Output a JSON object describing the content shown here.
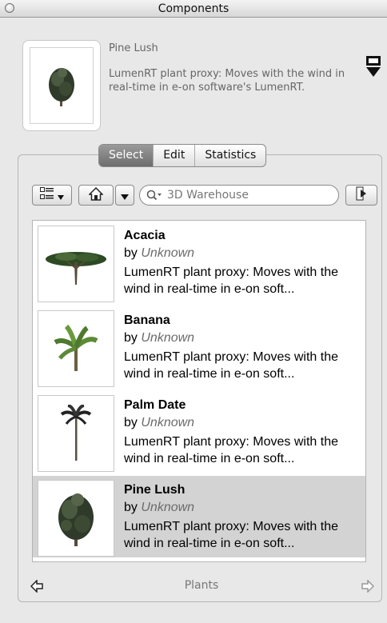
{
  "window": {
    "title": "Components"
  },
  "selected_component": {
    "name": "Pine Lush",
    "description": "LumenRT plant proxy: Moves with the wind in real-time in e-on software's LumenRT."
  },
  "tabs": [
    {
      "label": "Select",
      "active": true
    },
    {
      "label": "Edit",
      "active": false
    },
    {
      "label": "Statistics",
      "active": false
    }
  ],
  "search": {
    "placeholder": "3D Warehouse"
  },
  "items": [
    {
      "name": "Acacia",
      "by_prefix": "by",
      "author": "Unknown",
      "description": "LumenRT plant proxy: Moves with the wind in real-time in e-on soft...",
      "selected": false,
      "thumb": "acacia-tree-icon"
    },
    {
      "name": "Banana",
      "by_prefix": "by",
      "author": "Unknown",
      "description": "LumenRT plant proxy: Moves with the wind in real-time in e-on soft...",
      "selected": false,
      "thumb": "banana-plant-icon"
    },
    {
      "name": "Palm Date",
      "by_prefix": "by",
      "author": "Unknown",
      "description": "LumenRT plant proxy: Moves with the wind in real-time in e-on soft...",
      "selected": false,
      "thumb": "palm-tree-icon"
    },
    {
      "name": "Pine Lush",
      "by_prefix": "by",
      "author": "Unknown",
      "description": "LumenRT plant proxy: Moves with the wind in real-time in e-on soft...",
      "selected": true,
      "thumb": "pine-tree-icon"
    }
  ],
  "bottom_nav": {
    "category": "Plants"
  },
  "colors": {
    "selected_row": "#d3d3d3",
    "active_tab": "#7a7a7a"
  }
}
